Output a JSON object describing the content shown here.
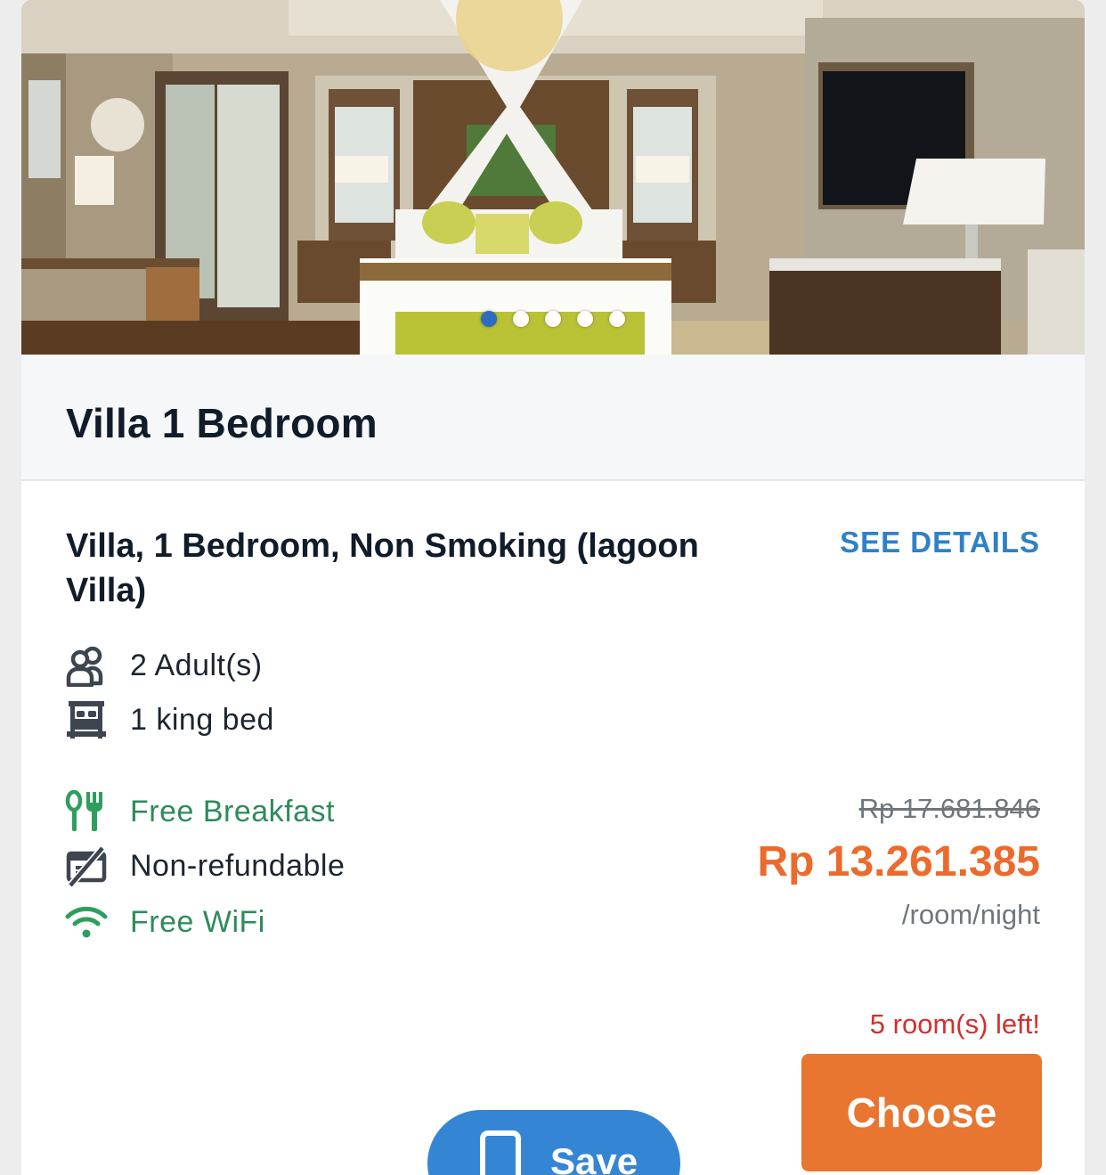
{
  "photo": {
    "carousel_total": 5,
    "carousel_active": 1
  },
  "room": {
    "title": "Villa 1 Bedroom"
  },
  "rate": {
    "name": "Villa, 1 Bedroom, Non Smoking (lagoon Villa)",
    "see_details_label": "SEE DETAILS",
    "occupancy": "2 Adult(s)",
    "bed": "1 king bed",
    "amenities": [
      {
        "icon": "fork-knife-icon",
        "label": "Free Breakfast",
        "color": "#2e8b5a"
      },
      {
        "icon": "non-refundable-icon",
        "label": "Non-refundable",
        "color": "#1c2530"
      },
      {
        "icon": "wifi-icon",
        "label": "Free WiFi",
        "color": "#2e8b5a"
      }
    ],
    "original_price": "Rp 17.681.846",
    "price": "Rp 13.261.385",
    "price_unit": "/room/night",
    "availability": "5 room(s) left!",
    "choose_label": "Choose",
    "save_label": "Save"
  },
  "colors": {
    "accent_orange": "#e87530",
    "price_orange": "#ec6a2c",
    "link_blue": "#2f80c8",
    "save_blue": "#3486d4",
    "green": "#2e8b5a",
    "alert_red": "#d3302d"
  }
}
